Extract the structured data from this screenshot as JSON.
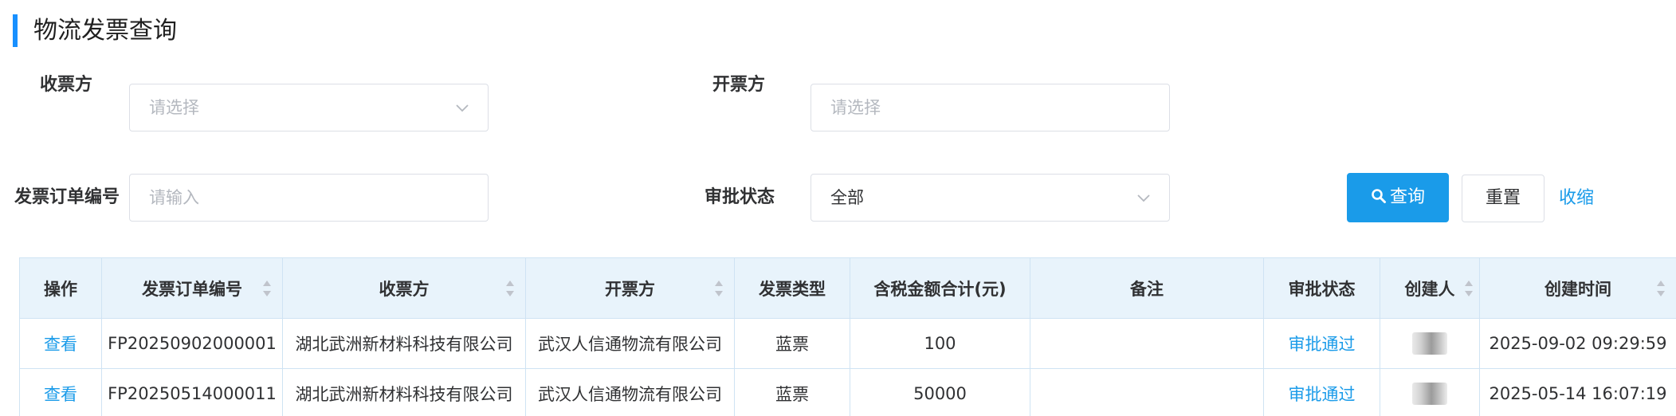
{
  "page": {
    "title": "物流发票查询"
  },
  "filters": {
    "receiver": {
      "label": "收票方",
      "placeholder": "请选择"
    },
    "issuer": {
      "label": "开票方",
      "placeholder": "请选择"
    },
    "order_no": {
      "label": "发票订单编号",
      "placeholder": "请输入"
    },
    "approval_status": {
      "label": "审批状态",
      "value": "全部"
    },
    "search_label": "查询",
    "reset_label": "重置",
    "collapse_label": "收缩"
  },
  "table": {
    "columns": [
      {
        "key": "action",
        "label": "操作",
        "sortable": false
      },
      {
        "key": "order_no",
        "label": "发票订单编号",
        "sortable": true
      },
      {
        "key": "receiver",
        "label": "收票方",
        "sortable": true
      },
      {
        "key": "issuer",
        "label": "开票方",
        "sortable": true
      },
      {
        "key": "invoice_type",
        "label": "发票类型",
        "sortable": false
      },
      {
        "key": "amount",
        "label": "含税金额合计(元)",
        "sortable": false
      },
      {
        "key": "remark",
        "label": "备注",
        "sortable": false
      },
      {
        "key": "status",
        "label": "审批状态",
        "sortable": false
      },
      {
        "key": "creator",
        "label": "创建人",
        "sortable": true
      },
      {
        "key": "created_at",
        "label": "创建时间",
        "sortable": true
      }
    ],
    "rows": [
      {
        "action": "查看",
        "order_no": "FP20250902000001",
        "receiver": "湖北武洲新材料科技有限公司",
        "issuer": "武汉人信通物流有限公司",
        "invoice_type": "蓝票",
        "amount": "100",
        "remark": "",
        "status": "审批通过",
        "creator": "",
        "created_at": "2025-09-02 09:29:59"
      },
      {
        "action": "查看",
        "order_no": "FP20250514000011",
        "receiver": "湖北武洲新材料科技有限公司",
        "issuer": "武汉人信通物流有限公司",
        "invoice_type": "蓝票",
        "amount": "50000",
        "remark": "",
        "status": "审批通过",
        "creator": "",
        "created_at": "2025-05-14 16:07:19"
      }
    ]
  },
  "colors": {
    "accent": "#1a9be9",
    "title_bar": "#1890ff",
    "header_bg": "#e8f3fb",
    "border": "#cfe3f3"
  },
  "icons": {
    "select_arrow": "chevron-down-icon",
    "search": "search-icon",
    "sort": "sort-caret-icon"
  }
}
